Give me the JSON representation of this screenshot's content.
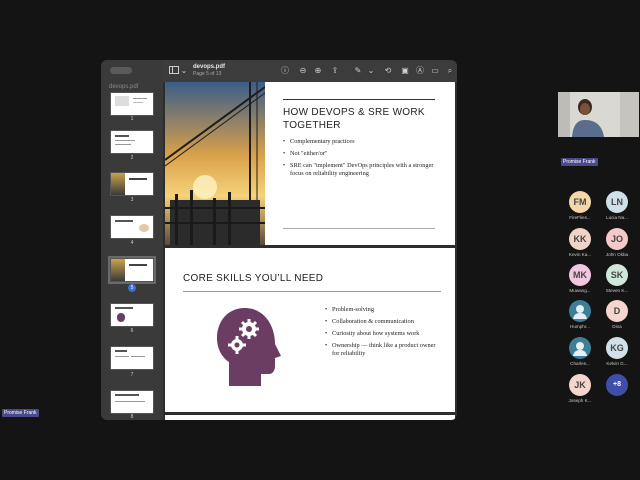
{
  "viewer": {
    "filename": "devops.pdf",
    "page_info": "Page 5 of 13",
    "sidebar_name": "devops.pdf",
    "thumbnails": [
      "1",
      "2",
      "3",
      "4",
      "5",
      "6",
      "7",
      "8"
    ],
    "selected_page": 5
  },
  "slides": {
    "slide1": {
      "title_line1": "HOW DEVOPS & SRE WORK",
      "title_line2": "TOGETHER",
      "bullets": [
        "Complementary practices",
        "Not \"either/or\"",
        "SRE can \"implement\" DevOps principles with a stronger focus on reliability engineering"
      ]
    },
    "slide2": {
      "title": "CORE SKILLS YOU’LL NEED",
      "bullets": [
        "Problem-solving",
        "Collaboration & communication",
        "Curiosity about how systems work",
        "Ownership — think like a product owner for reliability"
      ]
    }
  },
  "meeting": {
    "speaker_label": "Promise Frank",
    "self_label": "Promise Frank",
    "overflow_count": "+8",
    "participants": [
      {
        "initials": "FM",
        "name": "FireFlies...",
        "color": "#f3d7a8"
      },
      {
        "initials": "LN",
        "name": "Lucia Na...",
        "color": "#cfe0e8"
      },
      {
        "initials": "KK",
        "name": "Kevin Ka...",
        "color": "#f1d4c8"
      },
      {
        "initials": "JO",
        "name": "John Okba",
        "color": "#f4c9c9"
      },
      {
        "initials": "MK",
        "name": "Muwang...",
        "color": "#f2c6e0"
      },
      {
        "initials": "SK",
        "name": "Steven K...",
        "color": "#cfe8d9"
      },
      {
        "initials": "",
        "name": "Humphr...",
        "color": "#3d7f96",
        "icon": true
      },
      {
        "initials": "D",
        "name": "Dina",
        "color": "#f4d6cf"
      },
      {
        "initials": "",
        "name": "Charles...",
        "color": "#3d7f96",
        "icon": true
      },
      {
        "initials": "KG",
        "name": "Kelvin G...",
        "color": "#cfe0e8"
      },
      {
        "initials": "JK",
        "name": "Joseph K...",
        "color": "#f4d6cf"
      }
    ]
  }
}
